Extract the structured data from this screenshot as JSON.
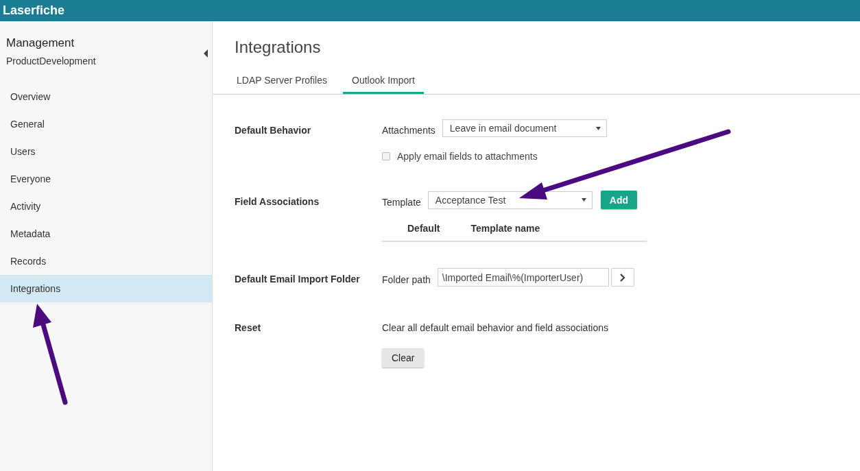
{
  "header": {
    "logo": "Laserfiche"
  },
  "sidebar": {
    "title": "Management",
    "subtitle": "ProductDevelopment",
    "collapsed": false,
    "items": [
      {
        "label": "Overview",
        "selected": false
      },
      {
        "label": "General",
        "selected": false
      },
      {
        "label": "Users",
        "selected": false
      },
      {
        "label": "Everyone",
        "selected": false
      },
      {
        "label": "Activity",
        "selected": false
      },
      {
        "label": "Metadata",
        "selected": false
      },
      {
        "label": "Records",
        "selected": false
      },
      {
        "label": "Integrations",
        "selected": true
      }
    ]
  },
  "page": {
    "title": "Integrations"
  },
  "tabs": [
    {
      "label": "LDAP Server Profiles",
      "selected": false
    },
    {
      "label": "Outlook Import",
      "selected": true
    }
  ],
  "sections": [
    {
      "kind": "behavior",
      "label": "Default Behavior",
      "select_label": "Attachments",
      "select_value": "Leave in email document",
      "checkbox": {
        "label": "Apply email fields to attachments",
        "checked": false
      }
    },
    {
      "kind": "associations",
      "label": "Field Associations",
      "select_label": "Template",
      "select_value": "Acceptance Test",
      "button": "Add",
      "columns": [
        "Default",
        "Template name"
      ]
    },
    {
      "kind": "folder",
      "label": "Default Email Import Folder",
      "field_label": "Folder path",
      "value": "\\Imported Email\\%(ImporterUser)"
    },
    {
      "kind": "reset",
      "label": "Reset",
      "text": "Clear all default email behavior and field associations",
      "button": "Clear"
    }
  ]
}
